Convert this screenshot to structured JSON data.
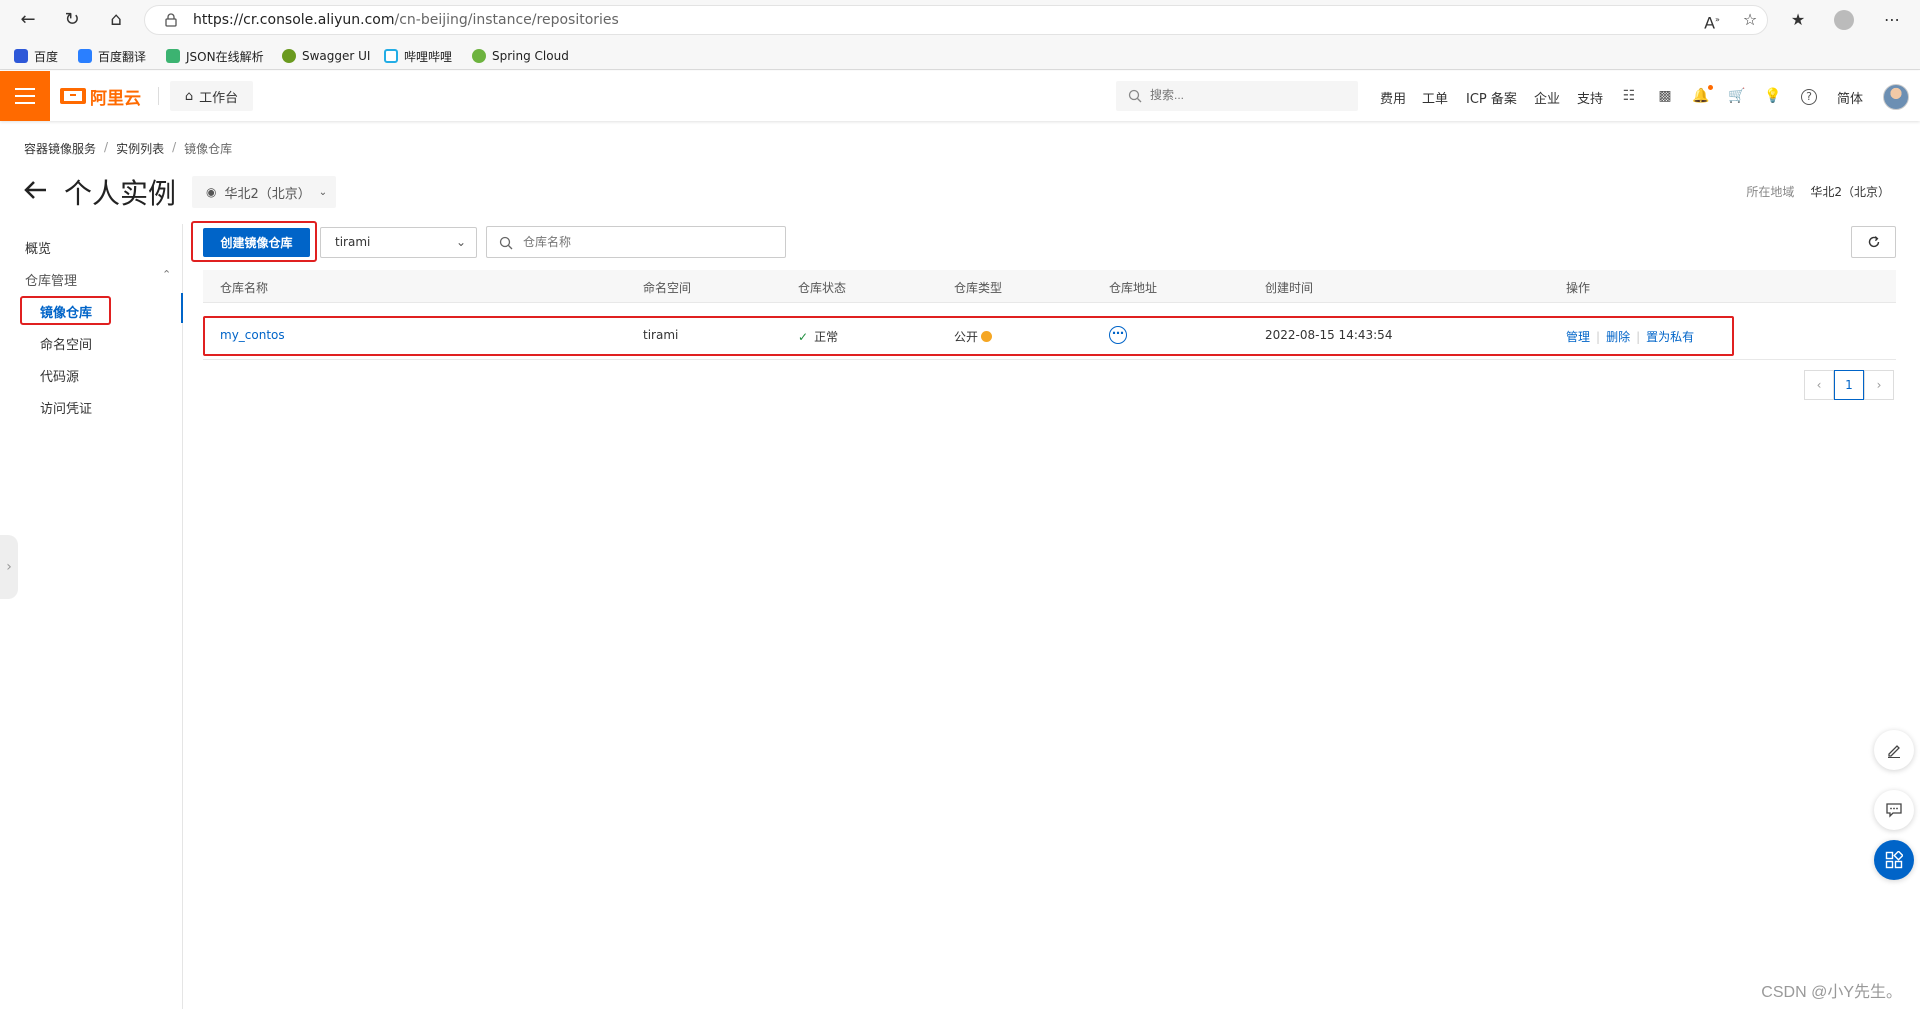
{
  "browser": {
    "url_host": "https://cr.console.aliyun.com",
    "url_path": "/cn-beijing/instance/repositories",
    "bookmarks": [
      "百度",
      "百度翻译",
      "JSON在线解析",
      "Swagger UI",
      "哔哩哔哩",
      "Spring Cloud"
    ]
  },
  "topbar": {
    "logo_text": "阿里云",
    "workbench": "工作台",
    "search_placeholder": "搜索...",
    "links": [
      "费用",
      "工单",
      "ICP 备案",
      "企业",
      "支持"
    ],
    "lang": "简体"
  },
  "breadcrumb": [
    "容器镜像服务",
    "实例列表",
    "镜像仓库"
  ],
  "page": {
    "title": "个人实例",
    "region_selected": "华北2（北京）",
    "region_label": "所在地域",
    "region_value": "华北2（北京）"
  },
  "sidebar": {
    "overview": "概览",
    "group": "仓库管理",
    "items": [
      "镜像仓库",
      "命名空间",
      "代码源",
      "访问凭证"
    ]
  },
  "toolbar": {
    "create_label": "创建镜像仓库",
    "namespace": "tirami",
    "search_placeholder": "仓库名称"
  },
  "table": {
    "headers": [
      "仓库名称",
      "命名空间",
      "仓库状态",
      "仓库类型",
      "仓库地址",
      "创建时间",
      "操作"
    ],
    "rows": [
      {
        "name": "my_contos",
        "namespace": "tirami",
        "status": "正常",
        "type": "公开",
        "created": "2022-08-15 14:43:54",
        "ops": [
          "管理",
          "删除",
          "置为私有"
        ]
      }
    ]
  },
  "pagination": {
    "current": "1"
  },
  "watermark": "CSDN @小Y先生。",
  "colors": {
    "brand": "#ff6a00",
    "primary": "#0064c8",
    "highlight": "#e02020",
    "success": "#1e8e3e",
    "warning": "#f5a623"
  }
}
